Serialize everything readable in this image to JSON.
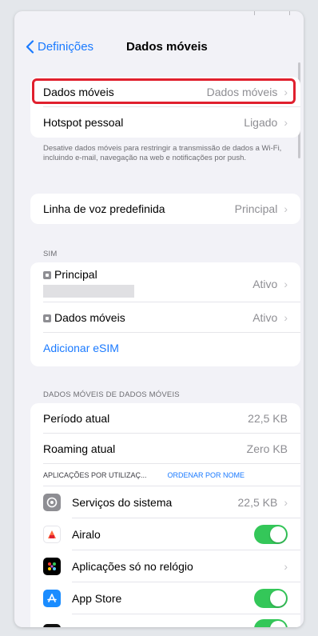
{
  "nav": {
    "back_label": "Definições",
    "title": "Dados móveis"
  },
  "group1": {
    "rows": [
      {
        "label": "Dados móveis",
        "value": "Dados móveis"
      },
      {
        "label": "Hotspot pessoal",
        "value": "Ligado"
      }
    ],
    "note": "Desative dados móveis para restringir a transmissão de dados a Wi-Fi, incluindo e-mail, navegação na web e notificações por push."
  },
  "voice": {
    "label": "Linha de voz predefinida",
    "value": "Principal"
  },
  "sim": {
    "section_label": "SIM",
    "rows": [
      {
        "label": "Principal",
        "value": "Ativo"
      },
      {
        "label": "Dados móveis",
        "value": "Ativo"
      }
    ],
    "add_esim": "Adicionar eSIM"
  },
  "usage": {
    "section_label": "DADOS MÓVEIS DE DADOS MÓVEIS",
    "current_period": {
      "label": "Período atual",
      "value": "22,5 KB"
    },
    "roaming": {
      "label": "Roaming atual",
      "value": "Zero KB"
    },
    "apps_header": "APLICAÇÕES POR UTILIZAÇ...",
    "sort_label": "ORDENAR POR NOME",
    "apps": [
      {
        "name": "Serviços do sistema",
        "value": "22,5 KB",
        "icon": "gear-icon"
      },
      {
        "name": "Airalo",
        "toggle": true,
        "icon": "airalo-icon"
      },
      {
        "name": "Aplicações só no relógio",
        "icon": "watch-apps-icon"
      },
      {
        "name": "App Store",
        "toggle": true,
        "icon": "app-store-icon"
      }
    ]
  },
  "colors": {
    "accent": "#1a7aff",
    "toggle_on": "#34c759",
    "highlight": "#e0202e"
  }
}
